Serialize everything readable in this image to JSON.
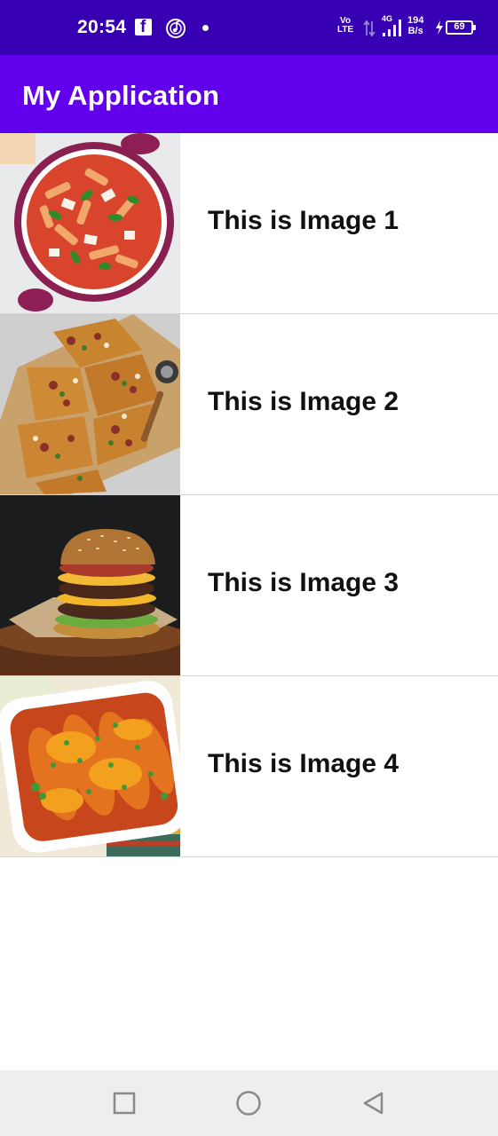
{
  "status_bar": {
    "time": "20:54",
    "network_type": "4G",
    "volte_top": "Vo",
    "volte_bottom": "LTE",
    "speed_value": "194",
    "speed_unit": "B/s",
    "battery_level": "69",
    "icons": [
      "facebook-icon",
      "music-icon",
      "notification-dot-icon",
      "data-arrows-icon",
      "signal-icon",
      "charging-bolt-icon",
      "battery-icon"
    ],
    "background_color": "#3700B3"
  },
  "app_bar": {
    "title": "My Application",
    "background_color": "#6200EE"
  },
  "list": {
    "items": [
      {
        "label": "This is Image 1",
        "image": "pasta dish"
      },
      {
        "label": "This is Image 2",
        "image": "pizza slices"
      },
      {
        "label": "This is Image 3",
        "image": "burger"
      },
      {
        "label": "This is Image 4",
        "image": "enchiladas"
      }
    ]
  },
  "nav_bar": {
    "icons": [
      "square-recents-icon",
      "circle-home-icon",
      "triangle-back-icon"
    ]
  }
}
